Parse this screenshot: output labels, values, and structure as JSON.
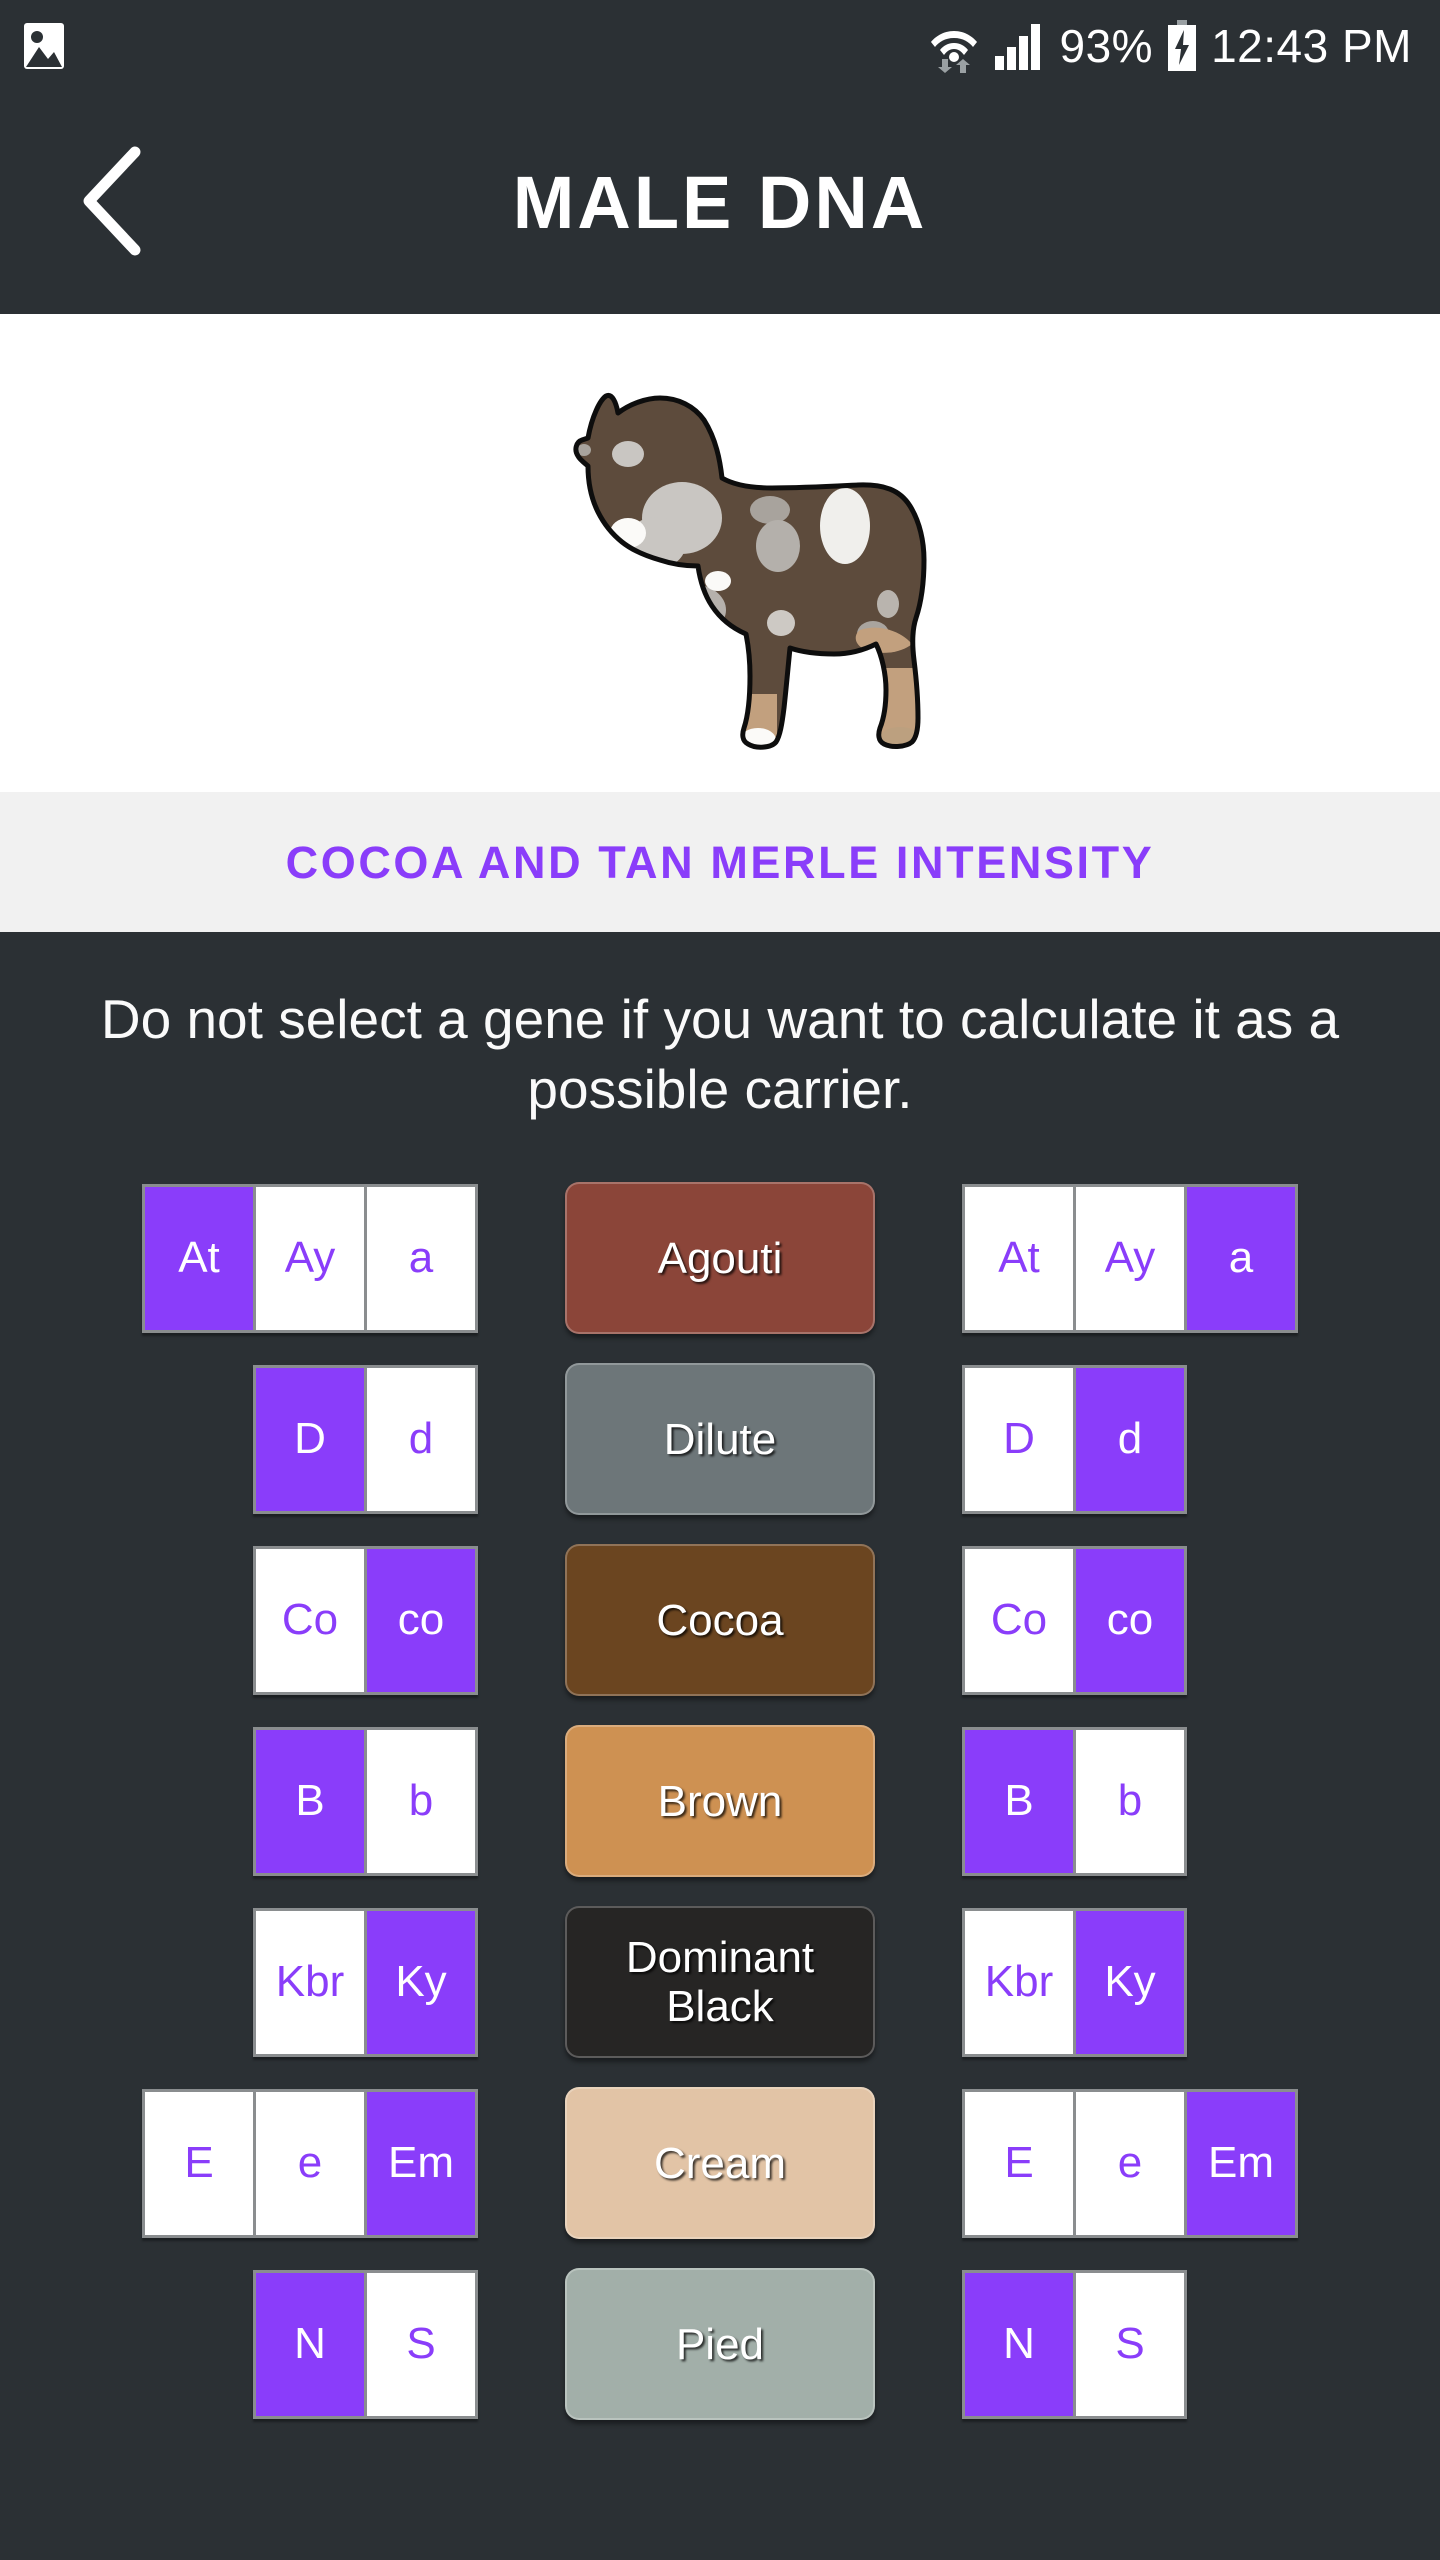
{
  "status_bar": {
    "gallery_icon": "image-icon",
    "wifi_icon": "wifi-icon",
    "signal_icon": "signal-bars-icon",
    "battery_percent": "93%",
    "battery_icon": "battery-charging-icon",
    "time": "12:43 PM"
  },
  "app_bar": {
    "back_icon": "chevron-left-icon",
    "title": "MALE DNA"
  },
  "dog_preview": {
    "alt": "cocoa and tan merle french bulldog illustration"
  },
  "subtitle": "COCOA AND TAN MERLE INTENSITY",
  "instructions": "Do not select a gene if you want to calculate it as a possible carrier.",
  "colors": {
    "accent_purple": "#8a3dfa",
    "background_dark": "#2b3034",
    "banner_light": "#f1f1f1",
    "cell_white": "#ffffff",
    "cell_border": "#8a8d8f"
  },
  "genes": [
    {
      "name": "Agouti",
      "button_color": "#8b4539",
      "left": [
        {
          "label": "At",
          "selected": true
        },
        {
          "label": "Ay",
          "selected": false
        },
        {
          "label": "a",
          "selected": false
        }
      ],
      "right": [
        {
          "label": "At",
          "selected": false
        },
        {
          "label": "Ay",
          "selected": false
        },
        {
          "label": "a",
          "selected": true
        }
      ]
    },
    {
      "name": "Dilute",
      "button_color": "#6d7679",
      "left": [
        {
          "label": "D",
          "selected": true
        },
        {
          "label": "d",
          "selected": false
        }
      ],
      "right": [
        {
          "label": "D",
          "selected": false
        },
        {
          "label": "d",
          "selected": true
        }
      ]
    },
    {
      "name": "Cocoa",
      "button_color": "#6b4520",
      "left": [
        {
          "label": "Co",
          "selected": false
        },
        {
          "label": "co",
          "selected": true
        }
      ],
      "right": [
        {
          "label": "Co",
          "selected": false
        },
        {
          "label": "co",
          "selected": true
        }
      ]
    },
    {
      "name": "Brown",
      "button_color": "#ce9152",
      "left": [
        {
          "label": "B",
          "selected": true
        },
        {
          "label": "b",
          "selected": false
        }
      ],
      "right": [
        {
          "label": "B",
          "selected": true
        },
        {
          "label": "b",
          "selected": false
        }
      ]
    },
    {
      "name": "Dominant Black",
      "button_color": "#262524",
      "left": [
        {
          "label": "Kbr",
          "selected": false
        },
        {
          "label": "Ky",
          "selected": true
        }
      ],
      "right": [
        {
          "label": "Kbr",
          "selected": false
        },
        {
          "label": "Ky",
          "selected": true
        }
      ]
    },
    {
      "name": "Cream",
      "button_color": "#e2c4a6",
      "left": [
        {
          "label": "E",
          "selected": false
        },
        {
          "label": "e",
          "selected": false
        },
        {
          "label": "Em",
          "selected": true
        }
      ],
      "right": [
        {
          "label": "E",
          "selected": false
        },
        {
          "label": "e",
          "selected": false
        },
        {
          "label": "Em",
          "selected": true
        }
      ]
    },
    {
      "name": "Pied",
      "button_color": "#a2afa9",
      "left": [
        {
          "label": "N",
          "selected": true
        },
        {
          "label": "S",
          "selected": false
        }
      ],
      "right": [
        {
          "label": "N",
          "selected": true
        },
        {
          "label": "S",
          "selected": false
        }
      ]
    }
  ]
}
